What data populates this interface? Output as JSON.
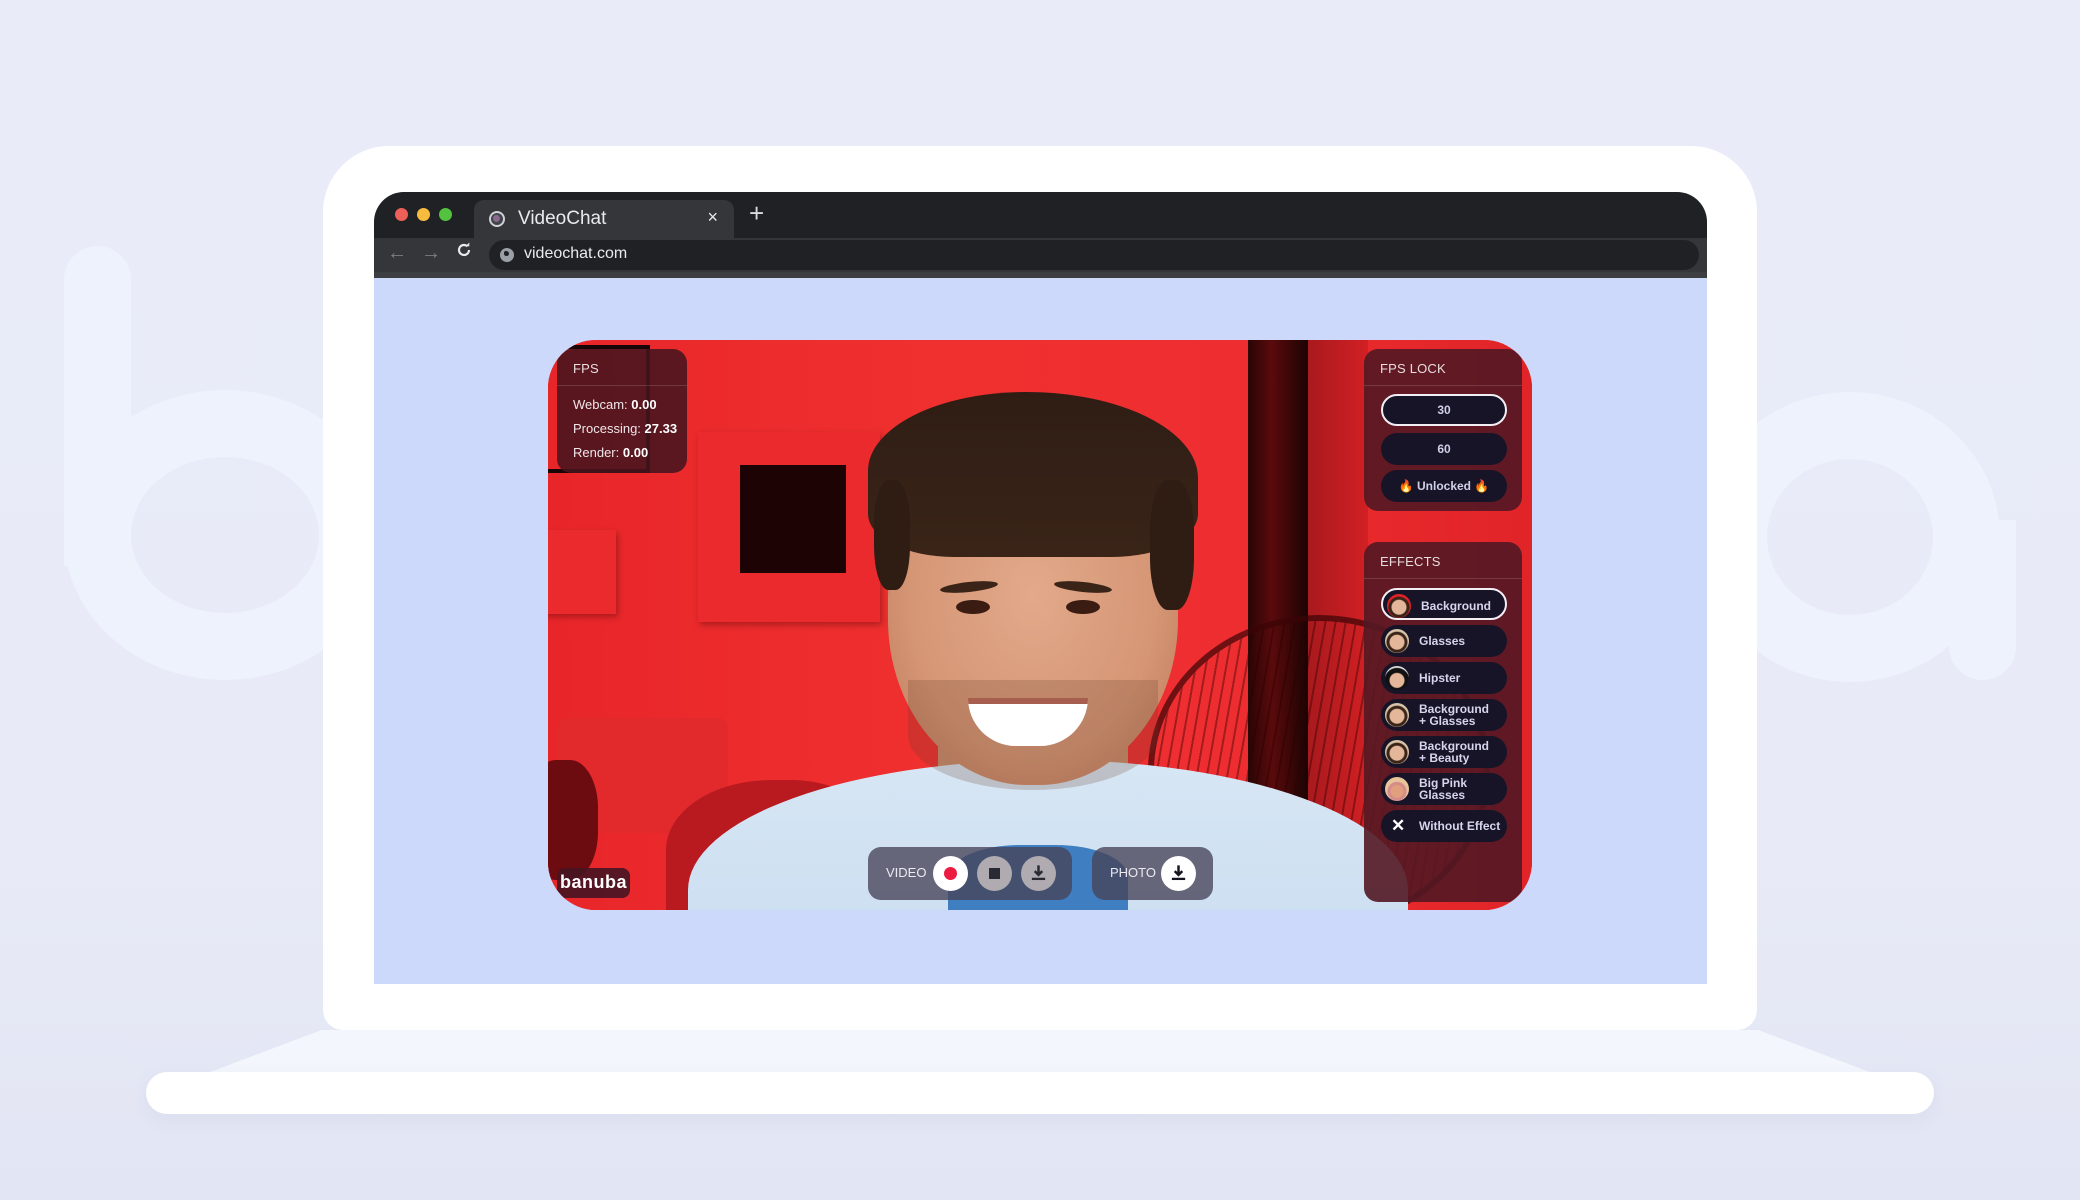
{
  "browser": {
    "tab_title": "VideoChat",
    "tab_close": "×",
    "new_tab": "+",
    "url": "videochat.com",
    "nav": {
      "back": "←",
      "forward": "→",
      "reload": "C"
    }
  },
  "fps": {
    "title": "FPS",
    "rows": [
      {
        "label": "Webcam:",
        "value": "0.00"
      },
      {
        "label": "Processing:",
        "value": "27.33"
      },
      {
        "label": "Render:",
        "value": "0.00"
      }
    ]
  },
  "fps_lock": {
    "title": "FPS LOCK",
    "options": [
      {
        "label": "30",
        "selected": true
      },
      {
        "label": "60",
        "selected": false
      },
      {
        "label": "🔥 Unlocked 🔥",
        "selected": false
      }
    ]
  },
  "effects": {
    "title": "EFFECTS",
    "items": [
      {
        "label": "Background",
        "selected": true
      },
      {
        "label": "Glasses",
        "selected": false
      },
      {
        "label": "Hipster",
        "selected": false
      },
      {
        "label": "Background + Glasses",
        "selected": false
      },
      {
        "label": "Background + Beauty",
        "selected": false
      },
      {
        "label": "Big Pink Glasses",
        "selected": false
      },
      {
        "label": "Without Effect",
        "selected": false,
        "icon": "close-icon"
      }
    ]
  },
  "controls": {
    "video_label": "VIDEO",
    "photo_label": "PHOTO"
  },
  "brand": {
    "logo_text": "banuba"
  },
  "colors": {
    "record": "#ec1b41",
    "page_bg": "#ccd9fb",
    "panel_bg": "#521824",
    "pill_bg": "#181428"
  }
}
